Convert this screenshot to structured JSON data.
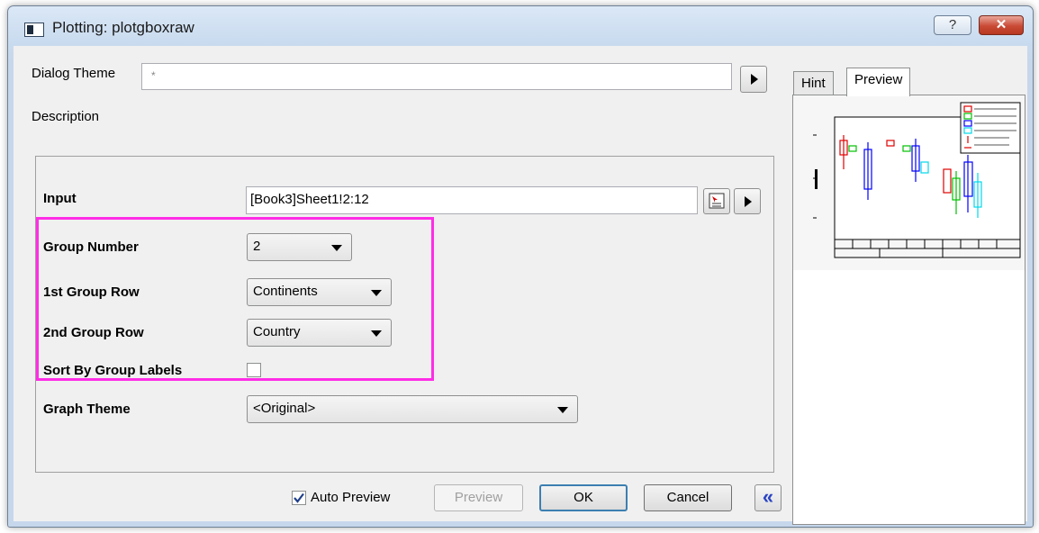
{
  "window": {
    "title": "Plotting: plotgboxraw",
    "help_glyph": "?",
    "close_glyph": "✕"
  },
  "theme": {
    "label": "Dialog Theme",
    "value": "*",
    "description_label": "Description"
  },
  "input": {
    "label": "Input",
    "value": "[Book3]Sheet1!2:12"
  },
  "group_number": {
    "label": "Group Number",
    "value": "2"
  },
  "first_group_row": {
    "label": "1st Group Row",
    "value": "Continents"
  },
  "second_group_row": {
    "label": "2nd Group Row",
    "value": "Country"
  },
  "sort_by_group_labels": {
    "label": "Sort By Group Labels",
    "checked": false
  },
  "graph_theme": {
    "label": "Graph Theme",
    "value": "<Original>"
  },
  "footer": {
    "auto_preview_label": "Auto Preview",
    "auto_preview_checked": true,
    "preview_label": "Preview",
    "ok_label": "OK",
    "cancel_label": "Cancel",
    "collapse_glyph": "«"
  },
  "tabs": [
    {
      "label": "Hint",
      "selected": false
    },
    {
      "label": "Preview",
      "selected": true
    }
  ],
  "colors": {
    "highlight": "#ff2de6",
    "red": "#e00000",
    "green": "#00c000",
    "blue": "#0000ff",
    "cyan": "#00d8e8"
  },
  "icons": [
    "app-icon",
    "help-icon",
    "close-icon",
    "arrow-right-icon",
    "select-range-icon",
    "dropdown-icon",
    "check-icon",
    "double-chevron-left-icon"
  ]
}
